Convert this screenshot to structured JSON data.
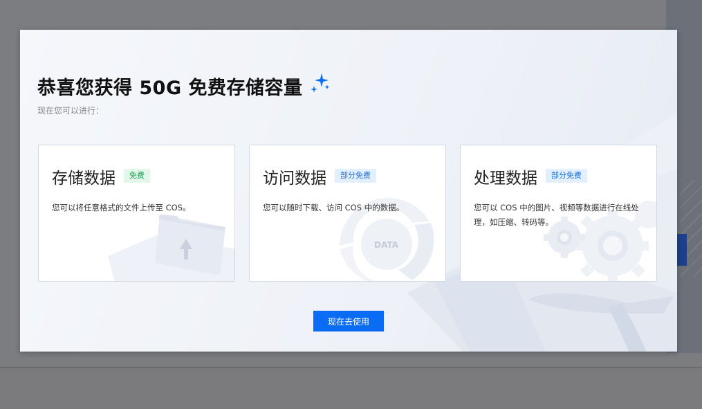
{
  "modal": {
    "title": "恭喜您获得 50G 免费存储容量",
    "subtitle": "现在您可以进行：",
    "accent_color": "#0a6cf5",
    "cards": [
      {
        "title": "存储数据",
        "badge": "免费",
        "badge_color": "green",
        "description": "您可以将任意格式的文件上传至 COS。",
        "illustration": "folder-upload-illustration"
      },
      {
        "title": "访问数据",
        "badge": "部分免费",
        "badge_color": "blue",
        "description": "您可以随时下载、访问 COS 中的数据。",
        "illustration": "data-ring-illustration",
        "illustration_text": "DATA"
      },
      {
        "title": "处理数据",
        "badge": "部分免费",
        "badge_color": "blue",
        "description": "您可以 COS 中的图片、视频等数据进行在线处理，如压缩、转码等。",
        "illustration": "gears-illustration"
      }
    ],
    "cta_label": "现在去使用"
  }
}
